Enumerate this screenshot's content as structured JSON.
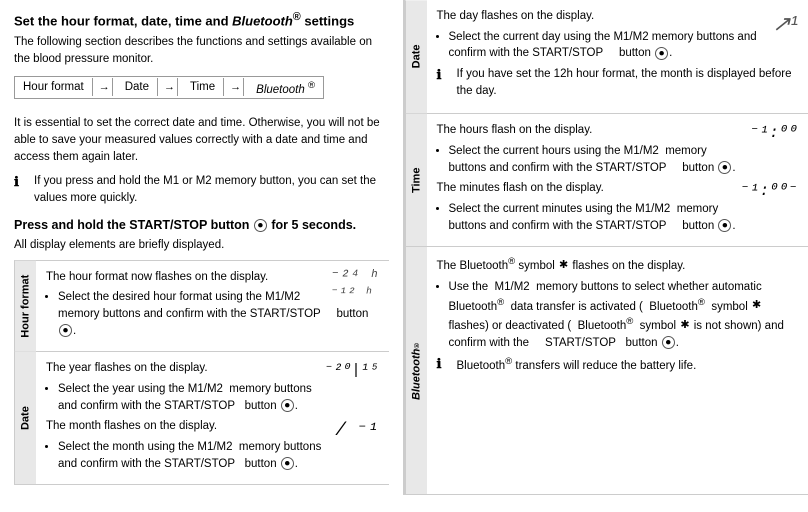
{
  "header": {
    "title": "Set the hour format, date, time and Bluetooth® settings",
    "subtitle": "The following section describes the functions and settings available on the blood pressure monitor."
  },
  "breadcrumb": {
    "items": [
      "Hour format",
      "→",
      "Date",
      "→",
      "Time",
      "→",
      "Bluetooth ®"
    ]
  },
  "info1": {
    "text": "It is essential to set the correct date and time. Otherwise, you will not be able to save your measured values correctly with a date and time and access them again later."
  },
  "info2": {
    "text": "If you press and hold the M1 or M2 memory button, you can set the values more quickly."
  },
  "press_heading": "Press and hold the START/STOP button",
  "press_text": " for 5 seconds.",
  "press_sub": "All display elements are briefly displayed.",
  "sections_left": [
    {
      "tab": "Hour format",
      "content_title": "The hour format now flashes on the display.",
      "bullets": [
        "Select the desired hour format using the M1/M2 memory buttons and confirm with the START/STOP button."
      ],
      "display": "24h / 12h"
    },
    {
      "tab": "Date",
      "paras": [
        "The year flashes on the display.",
        "The month flashes on the display."
      ],
      "bullets_year": [
        "Select the year using the M1/M2 memory buttons and confirm with the START/STOP button."
      ],
      "bullets_month": [
        "Select the month using the M1/M2 memory buttons and confirm with the START/STOP button."
      ],
      "display_year": "20|15",
      "display_month": "1"
    }
  ],
  "sections_right": [
    {
      "tab": "Date",
      "paras": [
        "The day flashes on the display."
      ],
      "bullets": [
        "Select the current day using the M1/M2 memory buttons and confirm with the START/STOP button."
      ],
      "info": "If you have set the 12h hour format, the month is displayed before the day.",
      "display": "↗1"
    },
    {
      "tab": "Time",
      "paras": [
        "The hours flash on the display.",
        "The minutes flash on the display."
      ],
      "bullets_hours": [
        "Select the current hours using the M1/M2 memory buttons and confirm with the START/STOP button."
      ],
      "bullets_minutes": [
        "Select the current minutes using the M1/M2 memory buttons and confirm with the START/STOP button."
      ],
      "display_hours": "1:00",
      "display_minutes": "1:00"
    },
    {
      "tab": "Bluetooth®",
      "paras": [
        "The Bluetooth® symbol flashes on the display."
      ],
      "bullets": [
        "Use the M1/M2 memory buttons to select whether automatic Bluetooth® data transfer is activated (Bluetooth® symbol flashes) or deactivated (Bluetooth® symbol is not shown) and confirm with the START/STOP button."
      ],
      "info": "Bluetooth® transfers will reduce the battery life."
    }
  ],
  "labels": {
    "hour_format": "Hour format",
    "date": "Date",
    "time": "Time",
    "bluetooth": "Bluetooth",
    "start_stop": "START/STOP"
  }
}
